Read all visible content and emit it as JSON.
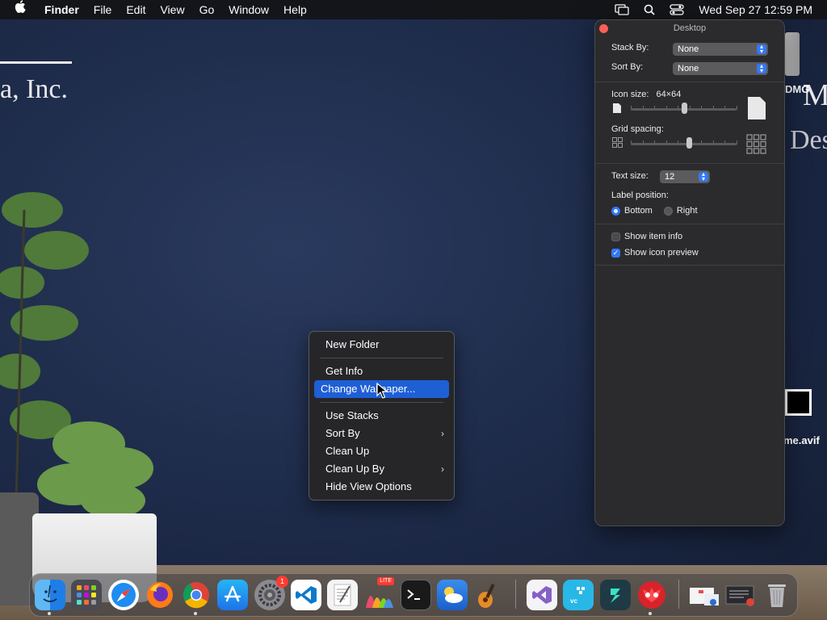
{
  "menubar": {
    "app_name": "Finder",
    "menus": [
      "File",
      "Edit",
      "View",
      "Go",
      "Window",
      "Help"
    ],
    "clock": "Wed Sep 27  12:59 PM"
  },
  "wallpaper": {
    "text_left": "a, Inc.",
    "text_right_top": "Mo",
    "text_right_bottom": "Des"
  },
  "desktop_icons": {
    "dmg_label": "DMG",
    "file_label": "me.avif"
  },
  "view_options": {
    "title": "Desktop",
    "stack_by_label": "Stack By:",
    "stack_by_value": "None",
    "sort_by_label": "Sort By:",
    "sort_by_value": "None",
    "icon_size_label": "Icon size:",
    "icon_size_value": "64×64",
    "icon_size_fraction": 0.5,
    "grid_spacing_label": "Grid spacing:",
    "grid_spacing_fraction": 0.55,
    "text_size_label": "Text size:",
    "text_size_value": "12",
    "label_position_label": "Label position:",
    "label_bottom": "Bottom",
    "label_right": "Right",
    "show_item_info": "Show item info",
    "show_icon_preview": "Show icon preview"
  },
  "context_menu": {
    "new_folder": "New Folder",
    "get_info": "Get Info",
    "change_wallpaper": "Change Wallpaper...",
    "use_stacks": "Use Stacks",
    "sort_by": "Sort By",
    "clean_up": "Clean Up",
    "clean_up_by": "Clean Up By",
    "hide_view_options": "Hide View Options"
  },
  "dock": {
    "settings_badge": "1",
    "grapher_badge": "LITE"
  }
}
